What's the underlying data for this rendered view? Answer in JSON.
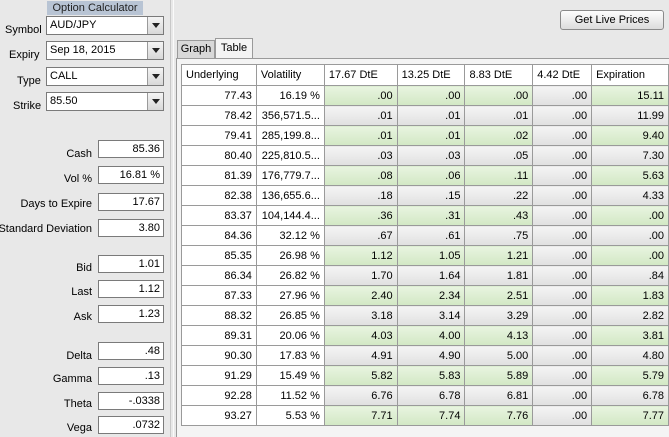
{
  "left": {
    "title": "Option Calculator",
    "symbol": {
      "label": "Symbol",
      "value": "AUD/JPY"
    },
    "expiry": {
      "label": "Expiry",
      "value": "Sep 18, 2015"
    },
    "type": {
      "label": "Type",
      "value": "CALL"
    },
    "strike": {
      "label": "Strike",
      "value": "85.50"
    },
    "fields": [
      {
        "label": "Cash",
        "value": "85.36"
      },
      {
        "label": "Vol %",
        "value": "16.81 %"
      },
      {
        "label": "Days to Expire",
        "value": "17.67"
      },
      {
        "label": "Standard Deviation",
        "value": "3.80"
      },
      {
        "label": "Bid",
        "value": "1.01"
      },
      {
        "label": "Last",
        "value": "1.12"
      },
      {
        "label": "Ask",
        "value": "1.23"
      },
      {
        "label": "Delta",
        "value": ".48"
      },
      {
        "label": "Gamma",
        "value": ".13"
      },
      {
        "label": "Theta",
        "value": "-.0338"
      },
      {
        "label": "Vega",
        "value": ".0732"
      }
    ]
  },
  "toolbar": {
    "live_prices": "Get Live Prices"
  },
  "tabs": [
    {
      "label": "Graph"
    },
    {
      "label": "Table"
    }
  ],
  "table": {
    "headers": [
      "Underlying",
      "Volatility",
      "17.67 DtE",
      "13.25 DtE",
      "8.83 DtE",
      "4.42 DtE",
      "Expiration"
    ],
    "rows": [
      [
        "77.43",
        "16.19 %",
        ".00",
        ".00",
        ".00",
        ".00",
        "15.11"
      ],
      [
        "78.42",
        "356,571.5...",
        ".01",
        ".01",
        ".01",
        ".00",
        "11.99"
      ],
      [
        "79.41",
        "285,199.8...",
        ".01",
        ".01",
        ".02",
        ".00",
        "9.40"
      ],
      [
        "80.40",
        "225,810.5...",
        ".03",
        ".03",
        ".05",
        ".00",
        "7.30"
      ],
      [
        "81.39",
        "176,779.7...",
        ".08",
        ".06",
        ".11",
        ".00",
        "5.63"
      ],
      [
        "82.38",
        "136,655.6...",
        ".18",
        ".15",
        ".22",
        ".00",
        "4.33"
      ],
      [
        "83.37",
        "104,144.4...",
        ".36",
        ".31",
        ".43",
        ".00",
        ".00"
      ],
      [
        "84.36",
        "32.12 %",
        ".67",
        ".61",
        ".75",
        ".00",
        ".00"
      ],
      [
        "85.35",
        "26.98 %",
        "1.12",
        "1.05",
        "1.21",
        ".00",
        ".00"
      ],
      [
        "86.34",
        "26.82 %",
        "1.70",
        "1.64",
        "1.81",
        ".00",
        ".84"
      ],
      [
        "87.33",
        "27.96 %",
        "2.40",
        "2.34",
        "2.51",
        ".00",
        "1.83"
      ],
      [
        "88.32",
        "26.85 %",
        "3.18",
        "3.14",
        "3.29",
        ".00",
        "2.82"
      ],
      [
        "89.31",
        "20.06 %",
        "4.03",
        "4.00",
        "4.13",
        ".00",
        "3.81"
      ],
      [
        "90.30",
        "17.83 %",
        "4.91",
        "4.90",
        "5.00",
        ".00",
        "4.80"
      ],
      [
        "91.29",
        "15.49 %",
        "5.82",
        "5.83",
        "5.89",
        ".00",
        "5.79"
      ],
      [
        "92.28",
        "11.52 %",
        "6.76",
        "6.78",
        "6.81",
        ".00",
        "6.78"
      ],
      [
        "93.27",
        "5.53 %",
        "7.71",
        "7.74",
        "7.76",
        ".00",
        "7.77"
      ]
    ]
  }
}
